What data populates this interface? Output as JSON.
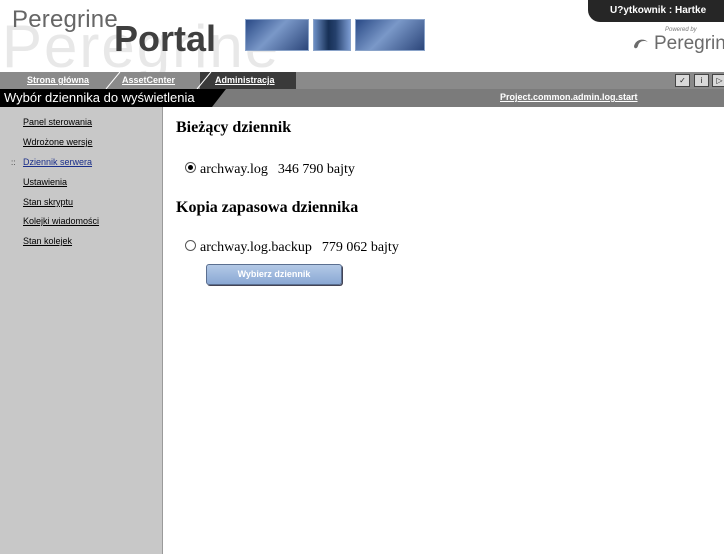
{
  "header": {
    "logo_word1": "Peregrine",
    "logo_word2": "Portal",
    "logo_ghost": "Peregrine",
    "user_label": "U?ytkownik : Hartke",
    "powered_by": "Powered by",
    "powered_brand": "Peregrine"
  },
  "nav": {
    "tabs": [
      {
        "label": "Strona główna"
      },
      {
        "label": "AssetCenter"
      },
      {
        "label": "Administracja"
      }
    ],
    "tools": [
      "✓",
      "i",
      "▷"
    ]
  },
  "titlebar": {
    "title": "Wybór dziennika do wyświetlenia",
    "link": "Project.common.admin.log.start"
  },
  "sidebar": {
    "items": [
      {
        "label": "Panel sterowania"
      },
      {
        "label": "Wdrożone wersje"
      },
      {
        "label": "Dziennik serwera"
      },
      {
        "label": "Ustawienia"
      },
      {
        "label": "Stan skryptu"
      },
      {
        "label": "Kolejki wiadomości"
      },
      {
        "label": "Stan kolejek"
      }
    ],
    "active_marker": "::"
  },
  "main": {
    "current_heading": "Bieżący dziennik",
    "current_file": "archway.log",
    "current_size": "346 790 bajty",
    "backup_heading": "Kopia zapasowa dziennika",
    "backup_file": "archway.log.backup",
    "backup_size": "779 062 bajty",
    "button_label": "Wybierz dziennik"
  },
  "colors": {
    "nav_bar": "#8a8a8a",
    "title_bar": "#000000",
    "sidebar": "#c8c8c8",
    "button": "#8aa8d4"
  }
}
